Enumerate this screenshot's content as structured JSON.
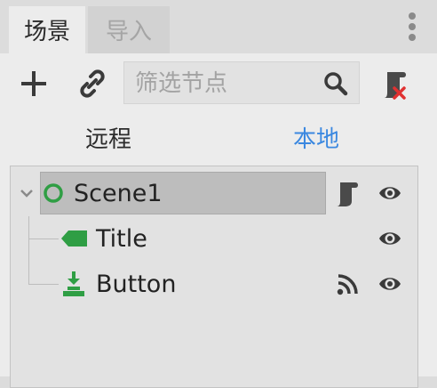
{
  "tabs": [
    {
      "label": "场景",
      "active": true
    },
    {
      "label": "导入",
      "active": false
    }
  ],
  "toolbar": {
    "filter_placeholder": "筛选节点"
  },
  "view_toggle": {
    "remote": "远程",
    "local": "本地",
    "selected": "本地"
  },
  "tree": {
    "nodes": [
      {
        "label": "Scene1",
        "icon": "node-circle-icon",
        "selected": true,
        "expanded": true,
        "has_script": true,
        "visible": true
      },
      {
        "label": "Title",
        "icon": "label-tag-icon",
        "visible": true
      },
      {
        "label": "Button",
        "icon": "button-icon",
        "has_signal": true,
        "visible": true
      }
    ]
  },
  "colors": {
    "accent": "#3b88e0",
    "node_green": "#2f9e44",
    "close_red": "#e03131",
    "selected_row": "#bdbdbd"
  }
}
